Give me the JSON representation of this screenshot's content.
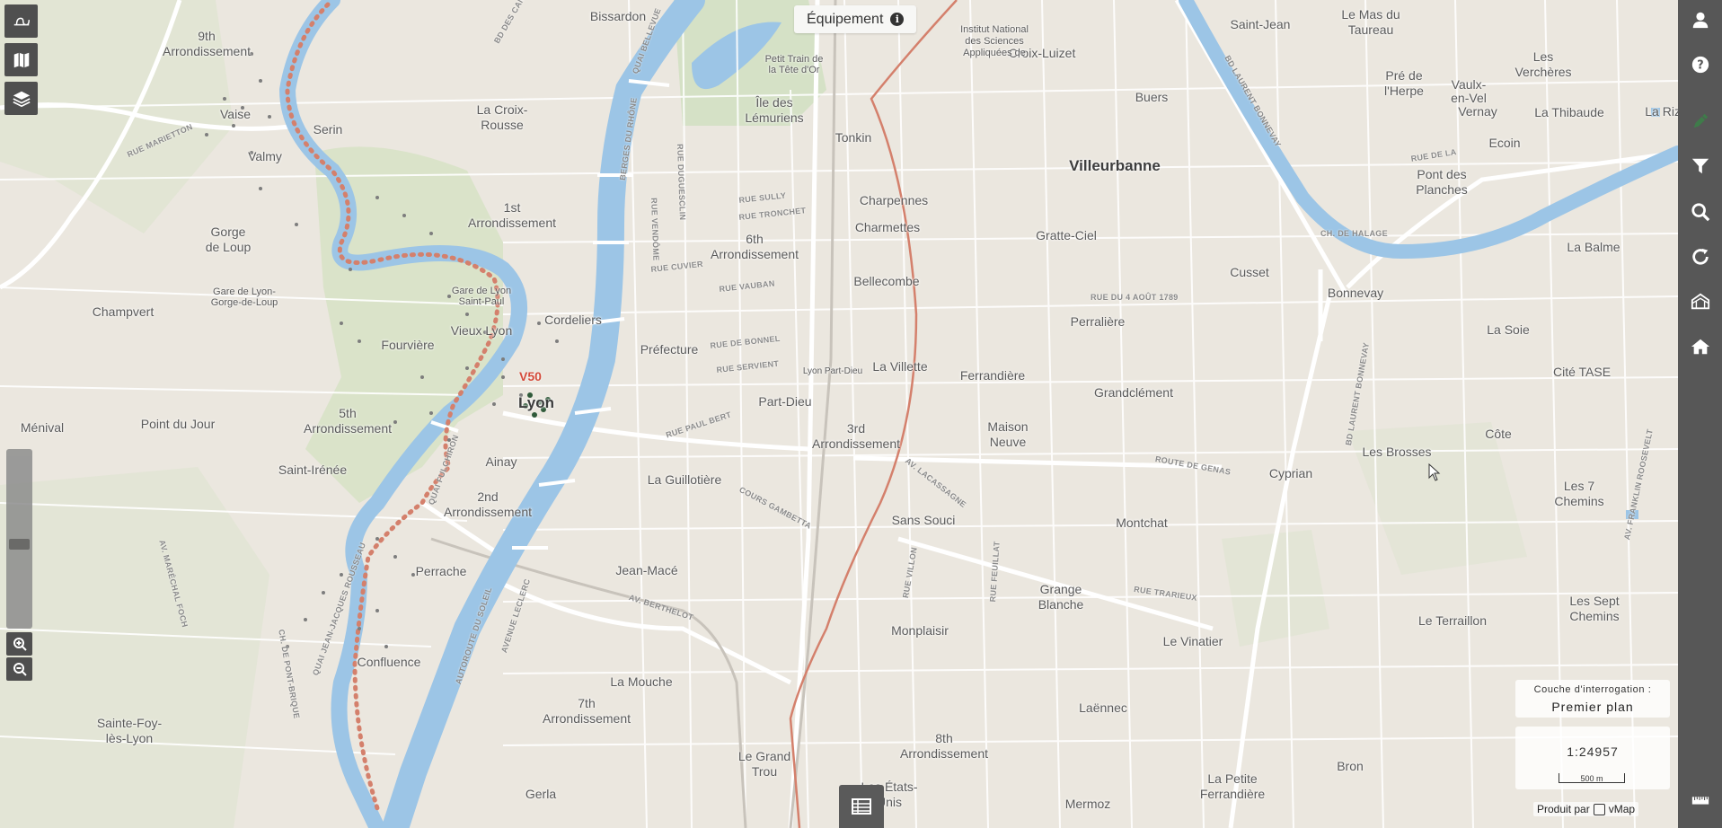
{
  "equipment": {
    "label": "Équipement",
    "info_icon": "info-icon"
  },
  "left_toolbar": [
    {
      "name": "logo-icon"
    },
    {
      "name": "map-icon"
    },
    {
      "name": "layers-icon"
    }
  ],
  "zoom": {
    "in_icon": "zoom-in-icon",
    "out_icon": "zoom-out-icon"
  },
  "right_toolbar": [
    {
      "name": "user-icon"
    },
    {
      "name": "help-icon"
    },
    {
      "name": "edit-pen-icon"
    },
    {
      "name": "filter-icon"
    },
    {
      "name": "search-icon"
    },
    {
      "name": "refresh-icon"
    },
    {
      "name": "map-view-icon"
    },
    {
      "name": "home-icon"
    },
    {
      "name": "ruler-icon"
    }
  ],
  "query_panel": {
    "label": "Couche d'interrogation :",
    "value": "Premier plan"
  },
  "scale": {
    "ratio": "1:24957",
    "bar_label": "500 m"
  },
  "credit": {
    "prefix": "Produit par",
    "brand": "vMap"
  },
  "map_marker": {
    "label": "V50"
  },
  "places": [
    {
      "t": "Bissardon"
    },
    {
      "t": "9th"
    },
    {
      "t": "Arrondissement"
    },
    {
      "t": "Vaise"
    },
    {
      "t": "Valmy"
    },
    {
      "t": "Serin"
    },
    {
      "t": "La Croix-"
    },
    {
      "t": "Rousse"
    },
    {
      "t": "1st"
    },
    {
      "t": "Arrondissement"
    },
    {
      "t": "Gorge"
    },
    {
      "t": "de Loup"
    },
    {
      "t": "Champvert"
    },
    {
      "t": "Fourvière"
    },
    {
      "t": "Vieux Lyon"
    },
    {
      "t": "Cordeliers"
    },
    {
      "t": "Lyon"
    },
    {
      "t": "5th"
    },
    {
      "t": "Arrondissement"
    },
    {
      "t": "Ménival"
    },
    {
      "t": "Point du Jour"
    },
    {
      "t": "Saint-Irénée"
    },
    {
      "t": "Ainay"
    },
    {
      "t": "2nd"
    },
    {
      "t": "Arrondissement"
    },
    {
      "t": "Perrache"
    },
    {
      "t": "Confluence"
    },
    {
      "t": "Sainte-Foy-"
    },
    {
      "t": "lès-Lyon"
    },
    {
      "t": "Gerla"
    },
    {
      "t": "7th"
    },
    {
      "t": "Arrondissement"
    },
    {
      "t": "La Mouche"
    },
    {
      "t": "Jean-Macé"
    },
    {
      "t": "La Guillotière"
    },
    {
      "t": "Préfecture"
    },
    {
      "t": "6th"
    },
    {
      "t": "Arrondissement"
    },
    {
      "t": "Part-Dieu"
    },
    {
      "t": "Lyon Part-Dieu"
    },
    {
      "t": "Tonkin"
    },
    {
      "t": "Charpennes"
    },
    {
      "t": "Charmettes"
    },
    {
      "t": "Bellecombe"
    },
    {
      "t": "La Villette"
    },
    {
      "t": "3rd"
    },
    {
      "t": "Arrondissement"
    },
    {
      "t": "Sans Souci"
    },
    {
      "t": "Monplaisir"
    },
    {
      "t": "Le Grand"
    },
    {
      "t": "Trou"
    },
    {
      "t": "Les États-"
    },
    {
      "t": "Unis"
    },
    {
      "t": "8th"
    },
    {
      "t": "Arrondissement"
    },
    {
      "t": "Mermoz"
    },
    {
      "t": "Laënnec"
    },
    {
      "t": "Le Vinatier"
    },
    {
      "t": "Montchat"
    },
    {
      "t": "Grange"
    },
    {
      "t": "Blanche"
    },
    {
      "t": "Grandclément"
    },
    {
      "t": "Ferrandière"
    },
    {
      "t": "Perralière"
    },
    {
      "t": "Gratte-Ciel"
    },
    {
      "t": "Villeurbanne"
    },
    {
      "t": "Buers"
    },
    {
      "t": "Croix-Luizet"
    },
    {
      "t": "Cusset"
    },
    {
      "t": "Bonnevay"
    },
    {
      "t": "Cyprian"
    },
    {
      "t": "Les Brosses"
    },
    {
      "t": "Saint-Jean"
    },
    {
      "t": "Le Mas du"
    },
    {
      "t": "Taureau"
    },
    {
      "t": "Pré de"
    },
    {
      "t": "l'Herpe"
    },
    {
      "t": "Vaulx-"
    },
    {
      "t": "en-Vel"
    },
    {
      "t": "La Thibaude"
    },
    {
      "t": "Les"
    },
    {
      "t": "Verchères"
    },
    {
      "t": "Ecoin"
    },
    {
      "t": "Pont des"
    },
    {
      "t": "Planches"
    },
    {
      "t": "La Balme"
    },
    {
      "t": "La Soie"
    },
    {
      "t": "Cité TASE"
    },
    {
      "t": "Côte"
    },
    {
      "t": "Les 7"
    },
    {
      "t": "Chemins"
    },
    {
      "t": "Les Sept"
    },
    {
      "t": "Chemins"
    },
    {
      "t": "Le Terraillon"
    },
    {
      "t": "Bron"
    },
    {
      "t": "La Petite"
    },
    {
      "t": "Ferrandière"
    },
    {
      "t": "Île des"
    },
    {
      "t": "Lémuriens"
    },
    {
      "t": "Petit Train de"
    },
    {
      "t": "la Tête d'Or"
    },
    {
      "t": "Gare de Lyon"
    },
    {
      "t": "Saint-Paul"
    },
    {
      "t": "Gare de Lyon-"
    },
    {
      "t": "Gorge-de-Loup"
    },
    {
      "t": "Institut National"
    },
    {
      "t": "des Sciences"
    },
    {
      "t": "Appliquées de"
    },
    {
      "t": "Vernay"
    },
    {
      "t": "La Rize"
    },
    {
      "t": "Maison"
    },
    {
      "t": "Neuve"
    }
  ],
  "streets": [
    {
      "t": "QUAI BELLEVUE"
    },
    {
      "t": "BERGES DU RHÔNE"
    },
    {
      "t": "RUE VENDÔME"
    },
    {
      "t": "RUE DUGUESCLIN"
    },
    {
      "t": "RUE SULLY"
    },
    {
      "t": "RUE TRONCHET"
    },
    {
      "t": "RUE CUVIER"
    },
    {
      "t": "RUE VAUBAN"
    },
    {
      "t": "RUE DE BONNEL"
    },
    {
      "t": "RUE SERVIENT"
    },
    {
      "t": "RUE PAUL BERT"
    },
    {
      "t": "COURS GAMBETTA"
    },
    {
      "t": "AV. BERTHELOT"
    },
    {
      "t": "AV. LACASSAGNE"
    },
    {
      "t": "ROUTE DE GENAS"
    },
    {
      "t": "RUE TRARIEUX"
    },
    {
      "t": "RUE VILLON"
    },
    {
      "t": "RUE FEUILLAT"
    },
    {
      "t": "RUE DU 4 AOÛT 1789"
    },
    {
      "t": "BD LAURENT BONNEVAY"
    },
    {
      "t": "CH. DE HALAGE"
    },
    {
      "t": "AV. FRANKLIN ROOSEVELT"
    },
    {
      "t": "RUE MARIETTON"
    },
    {
      "t": "AV. MARÉCHAL FOCH"
    },
    {
      "t": "QUAI JEAN-JACQUES ROUSSEAU"
    },
    {
      "t": "AUTOROUTE DU SOLEIL"
    },
    {
      "t": "AVENUE LECLERC"
    },
    {
      "t": "QUAI FULCHIRON"
    },
    {
      "t": "BD DES CANUTS"
    },
    {
      "t": "BD LAURENT BONNEVAY"
    },
    {
      "t": "RUE DE LA"
    },
    {
      "t": "CH. DE PONT-BRIQUE"
    }
  ]
}
